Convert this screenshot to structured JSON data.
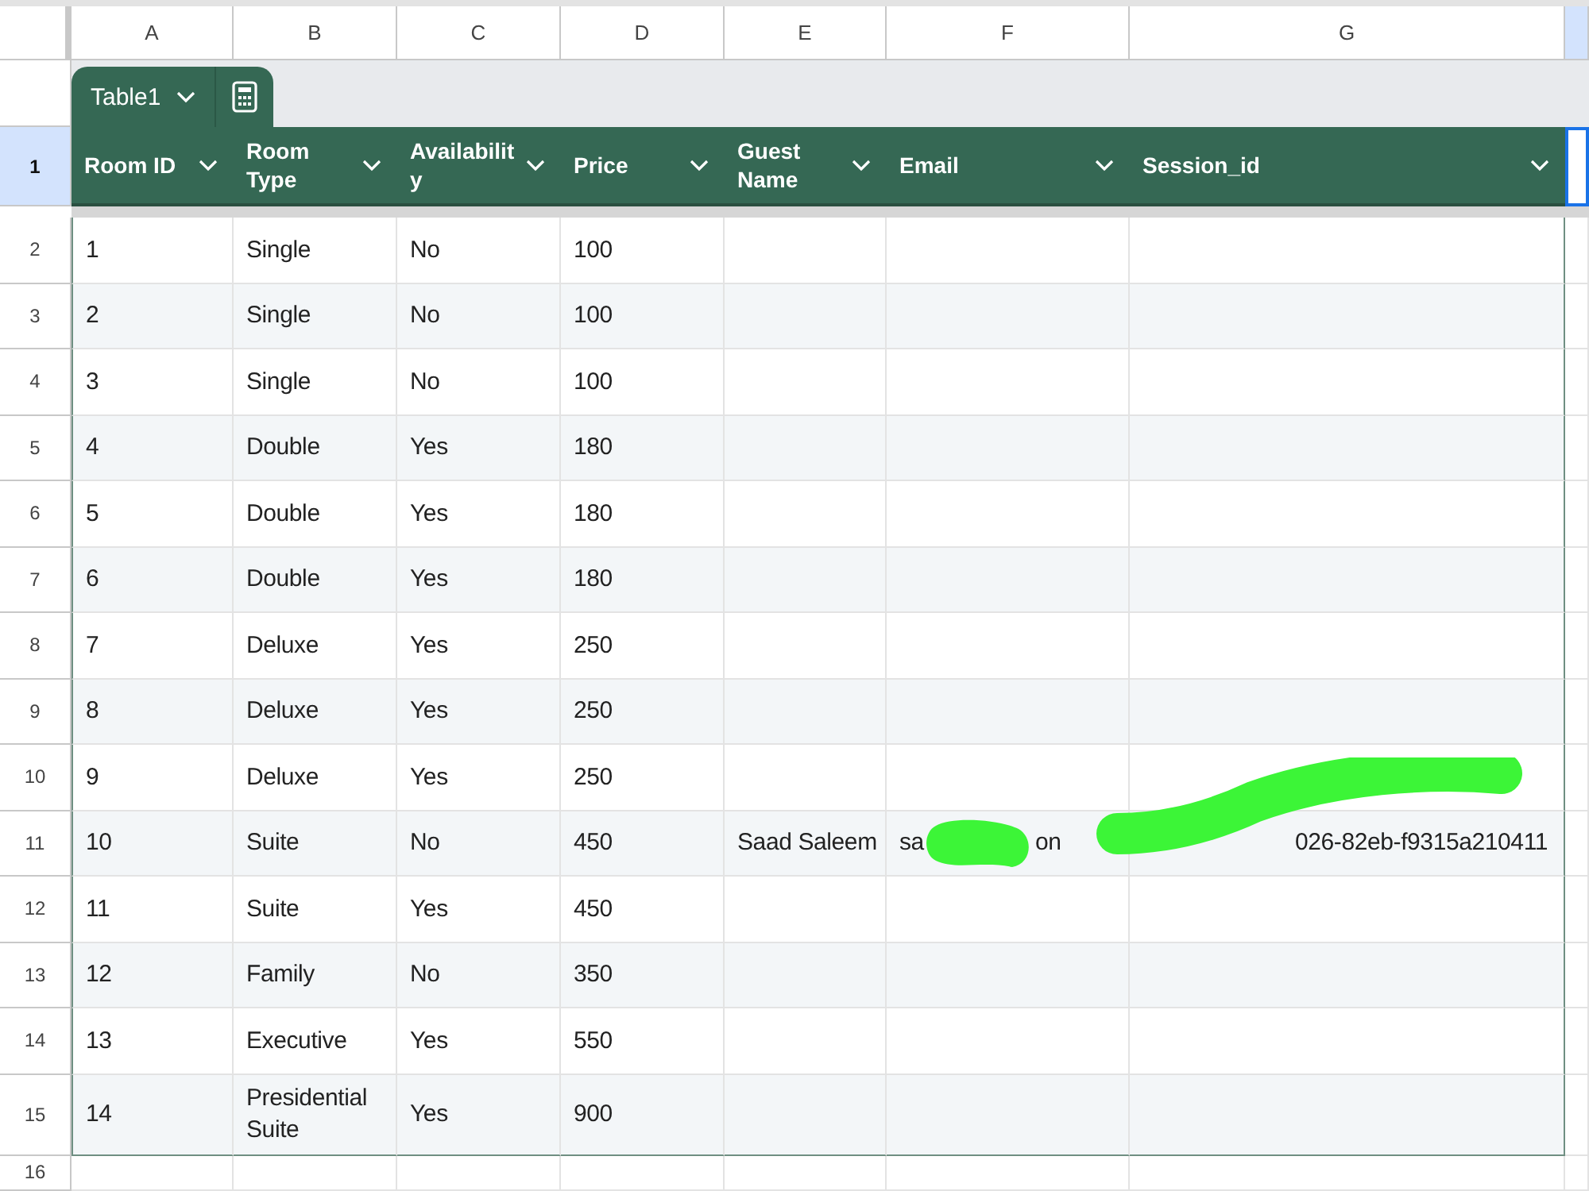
{
  "column_headers": [
    {
      "label": "A",
      "selected": false
    },
    {
      "label": "B",
      "selected": false
    },
    {
      "label": "C",
      "selected": false
    },
    {
      "label": "D",
      "selected": false
    },
    {
      "label": "E",
      "selected": false
    },
    {
      "label": "F",
      "selected": false
    },
    {
      "label": "G",
      "selected": false
    },
    {
      "selected": true
    }
  ],
  "table": {
    "name": "Table1",
    "columns": [
      "Room ID",
      "Room Type",
      "Availability",
      "Price",
      "Guest Name",
      "Email",
      "Session_id"
    ],
    "header_row": {
      "number": "1",
      "selected": true
    },
    "rows": [
      {
        "number": "2",
        "selected": false,
        "cells": [
          "1",
          "Single",
          "No",
          "100"
        ]
      },
      {
        "number": "3",
        "selected": false,
        "cells": [
          "2",
          "Single",
          "No",
          "100"
        ]
      },
      {
        "number": "4",
        "selected": false,
        "cells": [
          "3",
          "Single",
          "No",
          "100"
        ]
      },
      {
        "number": "5",
        "selected": false,
        "cells": [
          "4",
          "Double",
          "Yes",
          "180"
        ]
      },
      {
        "number": "6",
        "selected": false,
        "cells": [
          "5",
          "Double",
          "Yes",
          "180"
        ]
      },
      {
        "number": "7",
        "selected": false,
        "cells": [
          "6",
          "Double",
          "Yes",
          "180"
        ]
      },
      {
        "number": "8",
        "selected": false,
        "cells": [
          "7",
          "Deluxe",
          "Yes",
          "250"
        ]
      },
      {
        "number": "9",
        "selected": false,
        "cells": [
          "8",
          "Deluxe",
          "Yes",
          "250"
        ]
      },
      {
        "number": "10",
        "selected": false,
        "cells": [
          "9",
          "Deluxe",
          "Yes",
          "250"
        ]
      },
      {
        "number": "11",
        "selected": false,
        "cells": [
          "10",
          "Suite",
          "No",
          "450",
          "Saad Saleem",
          {
            "kind": "redacted_middle",
            "parts": [
              "sa",
              "on"
            ]
          },
          {
            "kind": "redacted_start",
            "parts": [
              "026-82eb-f9315a210411"
            ]
          }
        ]
      },
      {
        "number": "12",
        "selected": false,
        "cells": [
          "11",
          "Suite",
          "Yes",
          "450"
        ]
      },
      {
        "number": "13",
        "selected": false,
        "cells": [
          "12",
          "Family",
          "No",
          "350"
        ]
      },
      {
        "number": "14",
        "selected": false,
        "cells": [
          "13",
          "Executive",
          "Yes",
          "550"
        ]
      },
      {
        "number": "15",
        "selected": false,
        "cells": [
          "14",
          "Presidential Suite",
          "Yes",
          "900"
        ]
      }
    ]
  },
  "empty_rows": [
    {
      "number": "16",
      "selected": false
    }
  ]
}
